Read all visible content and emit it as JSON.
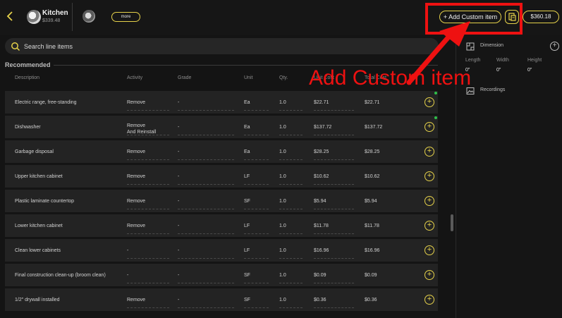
{
  "header": {
    "room_name": "Kitchen",
    "room_total": "$339.48",
    "more_label": "more",
    "add_custom_label": "+ Add Custom item",
    "estimate_total": "$360.18"
  },
  "search": {
    "placeholder": "Search line items"
  },
  "section": {
    "title": "Recommended"
  },
  "columns": [
    "Description",
    "Activity",
    "Grade",
    "Unit",
    "Qty.",
    "Unit Cost",
    "Total Cost"
  ],
  "rows": [
    {
      "description": "Electric range, free-standing",
      "activity": "Remove",
      "grade": "-",
      "unit": "Ea",
      "qty": "1.0",
      "unit_cost": "$22.71",
      "total_cost": "$22.71",
      "added": true
    },
    {
      "description": "Dishwasher",
      "activity": "Remove\nAnd Reinstall",
      "grade": "-",
      "unit": "Ea",
      "qty": "1.0",
      "unit_cost": "$137.72",
      "total_cost": "$137.72",
      "added": true
    },
    {
      "description": "Garbage disposal",
      "activity": "Remove",
      "grade": "-",
      "unit": "Ea",
      "qty": "1.0",
      "unit_cost": "$28.25",
      "total_cost": "$28.25",
      "added": false
    },
    {
      "description": "Upper kitchen cabinet",
      "activity": "Remove",
      "grade": "-",
      "unit": "LF",
      "qty": "1.0",
      "unit_cost": "$10.62",
      "total_cost": "$10.62",
      "added": false
    },
    {
      "description": "Plastic laminate countertop",
      "activity": "Remove",
      "grade": "-",
      "unit": "SF",
      "qty": "1.0",
      "unit_cost": "$5.94",
      "total_cost": "$5.94",
      "added": false
    },
    {
      "description": "Lower kitchen cabinet",
      "activity": "Remove",
      "grade": "-",
      "unit": "LF",
      "qty": "1.0",
      "unit_cost": "$11.78",
      "total_cost": "$11.78",
      "added": false
    },
    {
      "description": "Clean lower cabinets",
      "activity": "-",
      "grade": "-",
      "unit": "LF",
      "qty": "1.0",
      "unit_cost": "$16.96",
      "total_cost": "$16.96",
      "added": false
    },
    {
      "description": "Final construction clean-up (broom clean)",
      "activity": "-",
      "grade": "-",
      "unit": "SF",
      "qty": "1.0",
      "unit_cost": "$0.09",
      "total_cost": "$0.09",
      "added": false
    },
    {
      "description": "1/2\" drywall installed",
      "activity": "Remove",
      "grade": "-",
      "unit": "SF",
      "qty": "1.0",
      "unit_cost": "$0.36",
      "total_cost": "$0.36",
      "added": false
    }
  ],
  "panel": {
    "dimension_title": "Dimension",
    "length_label": "Length",
    "length_value": "0\"",
    "width_label": "Width",
    "width_value": "0\"",
    "height_label": "Height",
    "height_value": "0\"",
    "recordings_title": "Recordings"
  },
  "annotation": {
    "text": "Add Custom item",
    "color": "#ee1111"
  },
  "colors": {
    "accent": "#e6d24a",
    "row_bg": "#232323",
    "status_dot": "#2fbf4a"
  }
}
